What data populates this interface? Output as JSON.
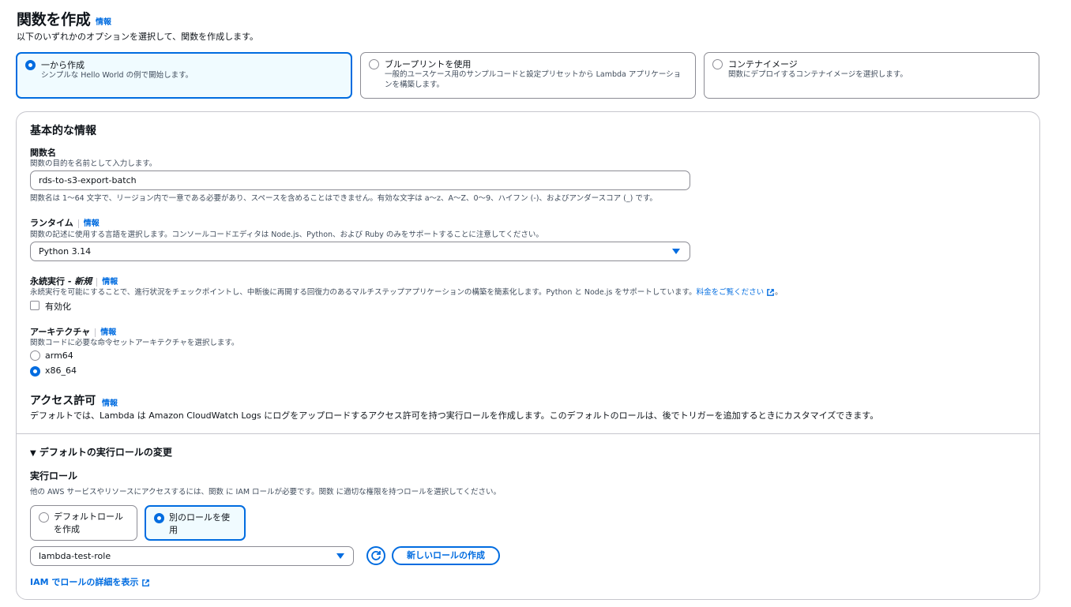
{
  "header": {
    "title": "関数を作成",
    "info": "情報",
    "description": "以下のいずれかのオプションを選択して、関数を作成します。"
  },
  "options": [
    {
      "title": "一から作成",
      "description": "シンプルな Hello World の例で開始します。",
      "selected": true
    },
    {
      "title": "ブループリントを使用",
      "description_line1": "一般的ユースケース用のサンプルコードと設定プリセットから Lambda アプリケーショ",
      "description_line2": "ンを構築します。",
      "selected": false
    },
    {
      "title": "コンテナイメージ",
      "description": "関数にデプロイするコンテナイメージを選択します。",
      "selected": false
    }
  ],
  "basic": {
    "heading": "基本的な情報",
    "function_name": {
      "label": "関数名",
      "description": "関数の目的を名前として入力します。",
      "value": "rds-to-s3-export-batch",
      "constraint": "関数名は 1〜64 文字で、リージョン内で一意である必要があり、スペースを含めることはできません。有効な文字は a〜z、A〜Z、0〜9、ハイフン (-)、およびアンダースコア (_) です。"
    },
    "runtime": {
      "label": "ランタイム",
      "info": "情報",
      "description": "関数の記述に使用する言語を選択します。コンソールコードエディタは Node.js、Python、および Ruby のみをサポートすることに注意してください。",
      "value": "Python 3.14"
    },
    "durable": {
      "label": "永続実行 - ",
      "label_new": "新規",
      "info": "情報",
      "description": "永続実行を可能にすることで、進行状況をチェックポイントし、中断後に再開する回復力のあるマルチステップアプリケーションの構築を簡素化します。Python と Node.js をサポートしています。",
      "pricing_link": "料金をご覧ください",
      "checkbox_label": "有効化"
    },
    "architecture": {
      "label": "アーキテクチャ",
      "info": "情報",
      "description": "関数コードに必要な命令セットアーキテクチャを選択します。",
      "options": [
        "arm64",
        "x86_64"
      ],
      "selected": "x86_64"
    },
    "permissions": {
      "heading": "アクセス許可",
      "info": "情報",
      "description": "デフォルトでは、Lambda は Amazon CloudWatch Logs にログをアップロードするアクセス許可を持つ実行ロールを作成します。このデフォルトのロールは、後でトリガーを追加するときにカスタマイズできます。"
    }
  },
  "role_section": {
    "toggle_label": "デフォルトの実行ロールの変更",
    "heading": "実行ロール",
    "description": "他の AWS サービスやリソースにアクセスするには、関数 に IAM ロールが必要です。関数 に適切な権限を持つロールを選択してください。",
    "option_default_line1": "デフォルトロール",
    "option_default_line2": "を作成",
    "option_existing_line1": "別のロールを使",
    "option_existing_line2": "用",
    "selected_role": "lambda-test-role",
    "new_role_button": "新しいロールの作成",
    "iam_link": "IAM でロールの詳細を表示"
  },
  "colors": {
    "accent": "#006ce0",
    "border": "#8c8c94",
    "selected_bg": "#f0fbff"
  }
}
